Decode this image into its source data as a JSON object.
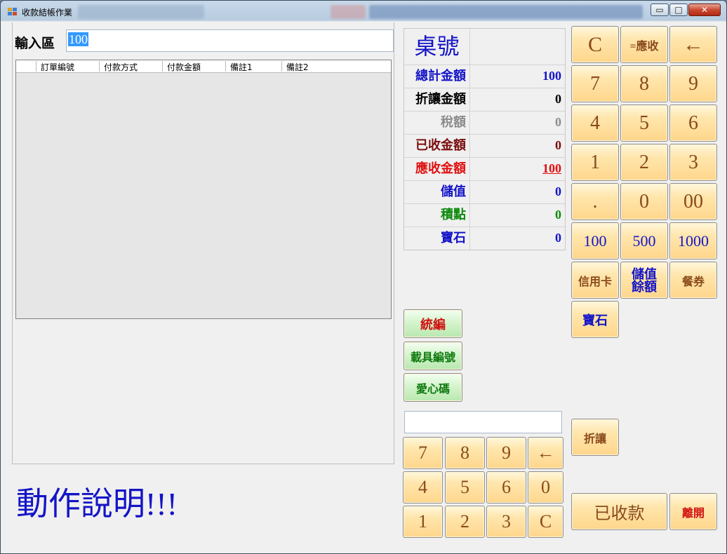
{
  "window": {
    "title": "收款結帳作業",
    "controls": {
      "minimize": "▭",
      "maximize": "□",
      "close": "✕"
    }
  },
  "input": {
    "label": "輸入區",
    "value": "100"
  },
  "grid": {
    "columns": [
      "訂單編號",
      "付款方式",
      "付款金額",
      "備註1",
      "備註2"
    ]
  },
  "help_text": "動作說明!!!",
  "table_label": "桌號",
  "table_value": "",
  "summary": [
    {
      "label": "總計金額",
      "value": "100",
      "color": "#1414c8"
    },
    {
      "label": "折讓金額",
      "value": "0",
      "color": "#000000"
    },
    {
      "label": "稅額",
      "value": "0",
      "color": "#8c8c8c"
    },
    {
      "label": "已收金額",
      "value": "0",
      "color": "#7a0d0d"
    },
    {
      "label": "應收金額",
      "value": "100",
      "color": "#e01010",
      "underline": true
    },
    {
      "label": "儲值",
      "value": "0",
      "color": "#1414c8"
    },
    {
      "label": "積點",
      "value": "0",
      "color": "#0f8a0f"
    },
    {
      "label": "寶石",
      "value": "0",
      "color": "#1414c8"
    }
  ],
  "invoice_buttons": {
    "tax_id": "統編",
    "carrier": "載具編號",
    "love_code": "愛心碼"
  },
  "small_input": {
    "value": ""
  },
  "small_keypad": [
    "7",
    "8",
    "9",
    "←",
    "4",
    "5",
    "6",
    "0",
    "1",
    "2",
    "3",
    "C"
  ],
  "main_keypad": {
    "clear": "C",
    "receivable": "=應收",
    "backspace": "←",
    "digits": [
      "7",
      "8",
      "9",
      "4",
      "5",
      "6",
      "1",
      "2",
      "3",
      ".",
      "0",
      "00"
    ],
    "amounts": [
      "100",
      "500",
      "1000"
    ],
    "credit_card": "信用卡",
    "stored_balance": "儲值餘額",
    "meal_voucher": "餐券",
    "gem": "寶石"
  },
  "discount_button": "折讓",
  "paid_button": "已收款",
  "exit_button": "離開",
  "colors": {
    "orange_text": "#8a4a1c",
    "blue_text": "#1414c8",
    "red_text": "#d01010",
    "green_text": "#0f7a0f"
  }
}
